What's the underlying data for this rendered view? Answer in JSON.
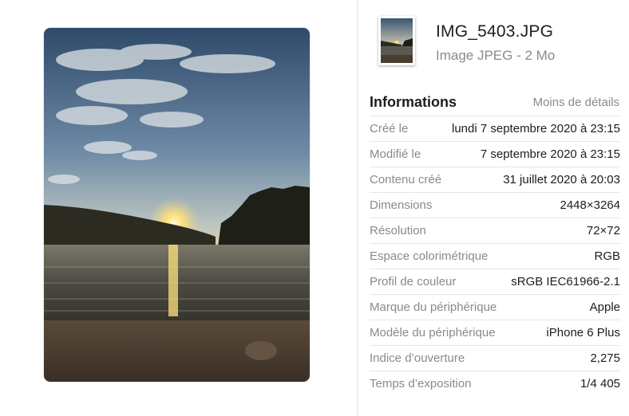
{
  "file": {
    "name": "IMG_5403.JPG",
    "kind": "Image JPEG - 2 Mo"
  },
  "info": {
    "title": "Informations",
    "toggle_label": "Moins de détails",
    "rows": [
      {
        "label": "Créé le",
        "value": "lundi 7 septembre 2020 à 23:15"
      },
      {
        "label": "Modifié le",
        "value": "7 septembre 2020 à 23:15"
      },
      {
        "label": "Contenu créé",
        "value": "31 juillet 2020 à 20:03"
      },
      {
        "label": "Dimensions",
        "value": "2448×3264"
      },
      {
        "label": "Résolution",
        "value": "72×72"
      },
      {
        "label": "Espace colorimétrique",
        "value": "RGB"
      },
      {
        "label": "Profil de couleur",
        "value": "sRGB IEC61966-2.1"
      },
      {
        "label": "Marque du périphérique",
        "value": "Apple"
      },
      {
        "label": "Modèle du périphérique",
        "value": "iPhone 6 Plus"
      },
      {
        "label": "Indice d’ouverture",
        "value": "2,275"
      },
      {
        "label": "Temps d’exposition",
        "value": "1/4 405"
      }
    ]
  },
  "colors": {
    "label_gray": "#8a8a8e",
    "text_dark": "#1d1d1f",
    "separator": "#e6e6e6"
  }
}
